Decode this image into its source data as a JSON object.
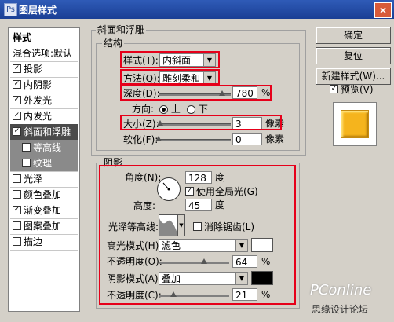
{
  "window": {
    "title": "图层样式",
    "close_glyph": "×",
    "app_glyph": "Ps"
  },
  "sidebar": {
    "header": "样式",
    "items": [
      {
        "label": "混合选项:默认",
        "checked": null
      },
      {
        "label": "投影",
        "checked": true
      },
      {
        "label": "内阴影",
        "checked": true
      },
      {
        "label": "外发光",
        "checked": true
      },
      {
        "label": "内发光",
        "checked": true
      },
      {
        "label": "斜面和浮雕",
        "checked": true
      },
      {
        "label": "等高线",
        "checked": false
      },
      {
        "label": "纹理",
        "checked": false
      },
      {
        "label": "光泽",
        "checked": false
      },
      {
        "label": "颜色叠加",
        "checked": false
      },
      {
        "label": "渐变叠加",
        "checked": true
      },
      {
        "label": "图案叠加",
        "checked": false
      },
      {
        "label": "描边",
        "checked": false
      }
    ]
  },
  "bevel": {
    "section_title": "斜面和浮雕",
    "structure_title": "结构",
    "style_label": "样式(T):",
    "style_value": "内斜面",
    "method_label": "方法(Q):",
    "method_value": "雕刻柔和",
    "depth_label": "深度(D):",
    "depth_value": "780",
    "depth_unit": "%",
    "depth_level": 0.88,
    "direction_label": "方向:",
    "direction_up": "上",
    "direction_down": "下",
    "size_label": "大小(Z):",
    "size_value": "3",
    "size_unit": "像素",
    "size_level": 0.02,
    "soften_label": "软化(F):",
    "soften_value": "0",
    "soften_unit": "像素",
    "soften_level": 0.0
  },
  "shading": {
    "title": "阴影",
    "angle_label": "角度(N):",
    "angle_value": "128",
    "angle_unit": "度",
    "global_light_label": "使用全局光(G)",
    "altitude_label": "高度:",
    "altitude_value": "45",
    "altitude_unit": "度",
    "gloss_label": "光泽等高线:",
    "antialias_label": "消除锯齿(L)",
    "highlight_mode_label": "高光模式(H):",
    "highlight_mode_value": "滤色",
    "highlight_color": "#ffffff",
    "highlight_opacity_label": "不透明度(O):",
    "highlight_opacity_value": "64",
    "highlight_opacity_unit": "%",
    "highlight_opacity_level": 0.64,
    "shadow_mode_label": "阴影模式(A):",
    "shadow_mode_value": "叠加",
    "shadow_color": "#000000",
    "shadow_opacity_label": "不透明度(C):",
    "shadow_opacity_value": "21",
    "shadow_opacity_unit": "%",
    "shadow_opacity_level": 0.21
  },
  "buttons": {
    "ok": "确定",
    "reset": "复位",
    "new_style": "新建样式(W)...",
    "preview_label": "预览(V)"
  },
  "preview_color": "#f5b41d",
  "watermark": {
    "line1": "PConline",
    "line2": "思缘设计论坛"
  },
  "accent": "#e6001a"
}
